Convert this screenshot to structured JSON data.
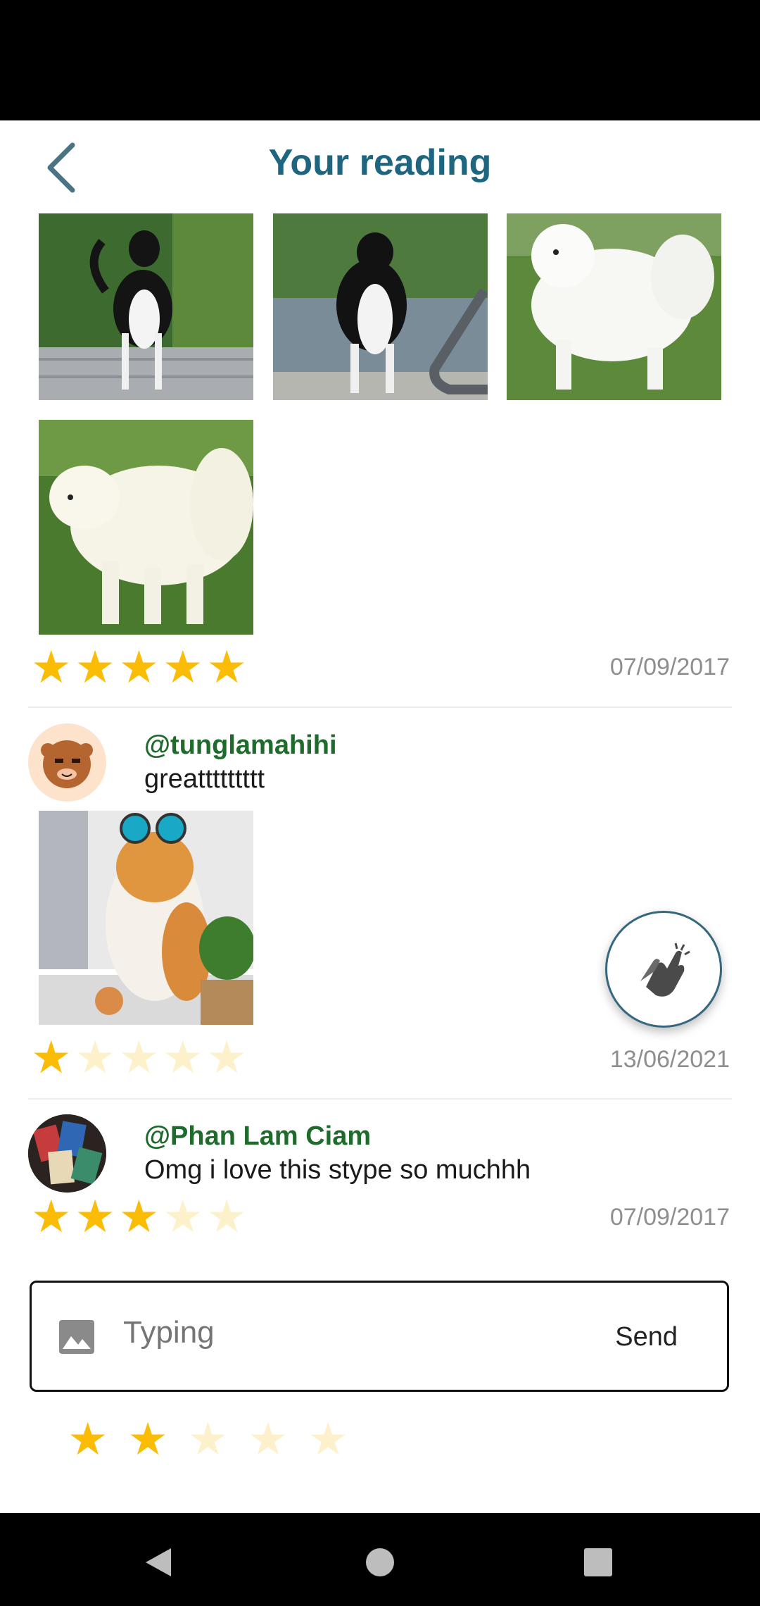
{
  "header": {
    "title": "Your reading"
  },
  "reviews": [
    {
      "rating": 5,
      "date": "07/09/2017"
    },
    {
      "username": "@tunglamahihi",
      "comment": "greattttttttt",
      "rating": 1,
      "date": "13/06/2021"
    },
    {
      "username": "@Phan Lam Ciam",
      "comment": "Omg i love this stype so muchhh",
      "rating": 3,
      "date": "07/09/2017"
    }
  ],
  "input": {
    "placeholder": "Typing",
    "send_label": "Send",
    "rating": 2
  },
  "icons": {
    "back": "chevron-left-icon",
    "clap": "clapping-hands-icon",
    "image": "image-icon"
  },
  "colors": {
    "title": "#1e6680",
    "username": "#1f6b2b",
    "star_on": "#fbbc05",
    "star_off": "#fdf1cc"
  }
}
